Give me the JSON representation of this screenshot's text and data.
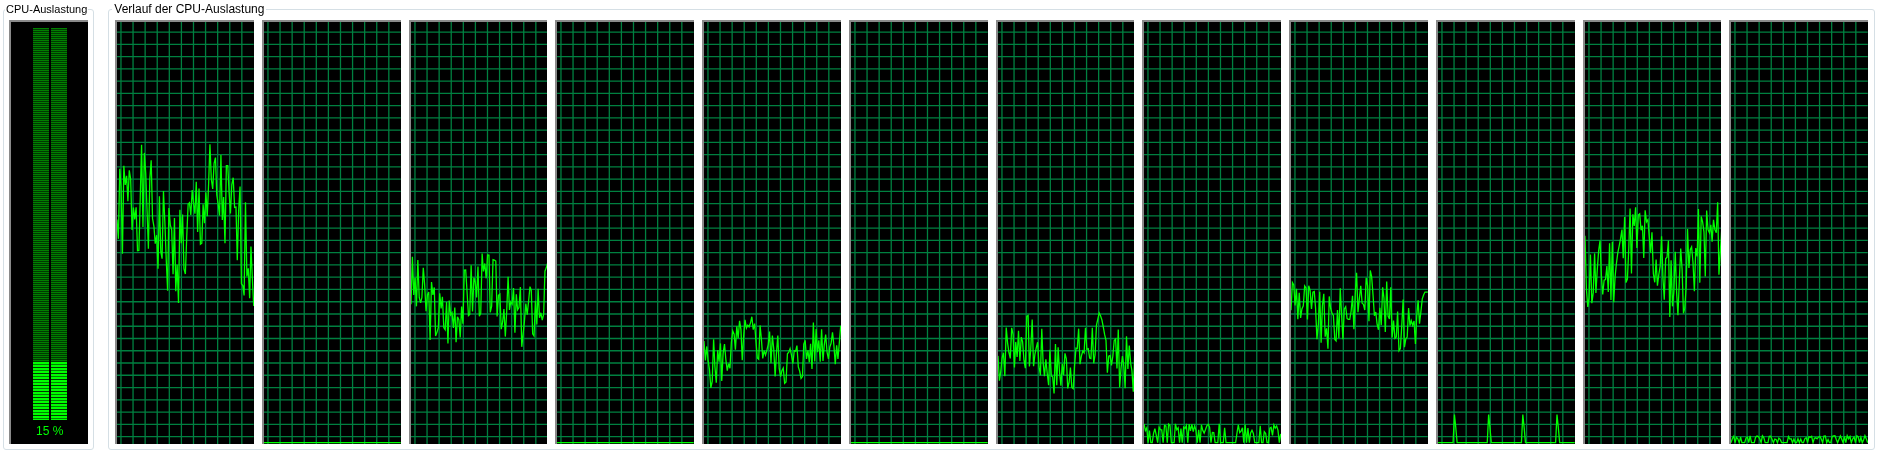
{
  "cpu_usage": {
    "title": "CPU-Auslastung",
    "meter": {
      "level": 0.15,
      "reading": "15 %"
    }
  },
  "cpu_history": {
    "title": "Verlauf der CPU-Auslastung"
  }
}
